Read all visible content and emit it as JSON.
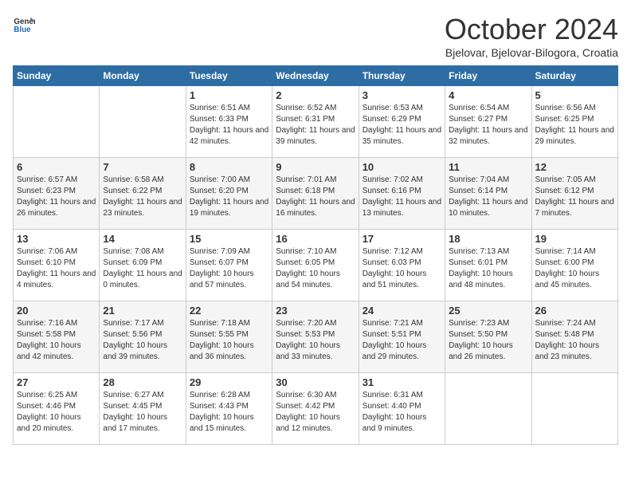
{
  "header": {
    "logo_general": "General",
    "logo_blue": "Blue",
    "title": "October 2024",
    "subtitle": "Bjelovar, Bjelovar-Bilogora, Croatia"
  },
  "weekdays": [
    "Sunday",
    "Monday",
    "Tuesday",
    "Wednesday",
    "Thursday",
    "Friday",
    "Saturday"
  ],
  "weeks": [
    [
      null,
      null,
      {
        "day": "1",
        "sunrise": "6:51 AM",
        "sunset": "6:33 PM",
        "daylight": "11 hours and 42 minutes."
      },
      {
        "day": "2",
        "sunrise": "6:52 AM",
        "sunset": "6:31 PM",
        "daylight": "11 hours and 39 minutes."
      },
      {
        "day": "3",
        "sunrise": "6:53 AM",
        "sunset": "6:29 PM",
        "daylight": "11 hours and 35 minutes."
      },
      {
        "day": "4",
        "sunrise": "6:54 AM",
        "sunset": "6:27 PM",
        "daylight": "11 hours and 32 minutes."
      },
      {
        "day": "5",
        "sunrise": "6:56 AM",
        "sunset": "6:25 PM",
        "daylight": "11 hours and 29 minutes."
      }
    ],
    [
      {
        "day": "6",
        "sunrise": "6:57 AM",
        "sunset": "6:23 PM",
        "daylight": "11 hours and 26 minutes."
      },
      {
        "day": "7",
        "sunrise": "6:58 AM",
        "sunset": "6:22 PM",
        "daylight": "11 hours and 23 minutes."
      },
      {
        "day": "8",
        "sunrise": "7:00 AM",
        "sunset": "6:20 PM",
        "daylight": "11 hours and 19 minutes."
      },
      {
        "day": "9",
        "sunrise": "7:01 AM",
        "sunset": "6:18 PM",
        "daylight": "11 hours and 16 minutes."
      },
      {
        "day": "10",
        "sunrise": "7:02 AM",
        "sunset": "6:16 PM",
        "daylight": "11 hours and 13 minutes."
      },
      {
        "day": "11",
        "sunrise": "7:04 AM",
        "sunset": "6:14 PM",
        "daylight": "11 hours and 10 minutes."
      },
      {
        "day": "12",
        "sunrise": "7:05 AM",
        "sunset": "6:12 PM",
        "daylight": "11 hours and 7 minutes."
      }
    ],
    [
      {
        "day": "13",
        "sunrise": "7:06 AM",
        "sunset": "6:10 PM",
        "daylight": "11 hours and 4 minutes."
      },
      {
        "day": "14",
        "sunrise": "7:08 AM",
        "sunset": "6:09 PM",
        "daylight": "11 hours and 0 minutes."
      },
      {
        "day": "15",
        "sunrise": "7:09 AM",
        "sunset": "6:07 PM",
        "daylight": "10 hours and 57 minutes."
      },
      {
        "day": "16",
        "sunrise": "7:10 AM",
        "sunset": "6:05 PM",
        "daylight": "10 hours and 54 minutes."
      },
      {
        "day": "17",
        "sunrise": "7:12 AM",
        "sunset": "6:03 PM",
        "daylight": "10 hours and 51 minutes."
      },
      {
        "day": "18",
        "sunrise": "7:13 AM",
        "sunset": "6:01 PM",
        "daylight": "10 hours and 48 minutes."
      },
      {
        "day": "19",
        "sunrise": "7:14 AM",
        "sunset": "6:00 PM",
        "daylight": "10 hours and 45 minutes."
      }
    ],
    [
      {
        "day": "20",
        "sunrise": "7:16 AM",
        "sunset": "5:58 PM",
        "daylight": "10 hours and 42 minutes."
      },
      {
        "day": "21",
        "sunrise": "7:17 AM",
        "sunset": "5:56 PM",
        "daylight": "10 hours and 39 minutes."
      },
      {
        "day": "22",
        "sunrise": "7:18 AM",
        "sunset": "5:55 PM",
        "daylight": "10 hours and 36 minutes."
      },
      {
        "day": "23",
        "sunrise": "7:20 AM",
        "sunset": "5:53 PM",
        "daylight": "10 hours and 33 minutes."
      },
      {
        "day": "24",
        "sunrise": "7:21 AM",
        "sunset": "5:51 PM",
        "daylight": "10 hours and 29 minutes."
      },
      {
        "day": "25",
        "sunrise": "7:23 AM",
        "sunset": "5:50 PM",
        "daylight": "10 hours and 26 minutes."
      },
      {
        "day": "26",
        "sunrise": "7:24 AM",
        "sunset": "5:48 PM",
        "daylight": "10 hours and 23 minutes."
      }
    ],
    [
      {
        "day": "27",
        "sunrise": "6:25 AM",
        "sunset": "4:46 PM",
        "daylight": "10 hours and 20 minutes."
      },
      {
        "day": "28",
        "sunrise": "6:27 AM",
        "sunset": "4:45 PM",
        "daylight": "10 hours and 17 minutes."
      },
      {
        "day": "29",
        "sunrise": "6:28 AM",
        "sunset": "4:43 PM",
        "daylight": "10 hours and 15 minutes."
      },
      {
        "day": "30",
        "sunrise": "6:30 AM",
        "sunset": "4:42 PM",
        "daylight": "10 hours and 12 minutes."
      },
      {
        "day": "31",
        "sunrise": "6:31 AM",
        "sunset": "4:40 PM",
        "daylight": "10 hours and 9 minutes."
      },
      null,
      null
    ]
  ]
}
